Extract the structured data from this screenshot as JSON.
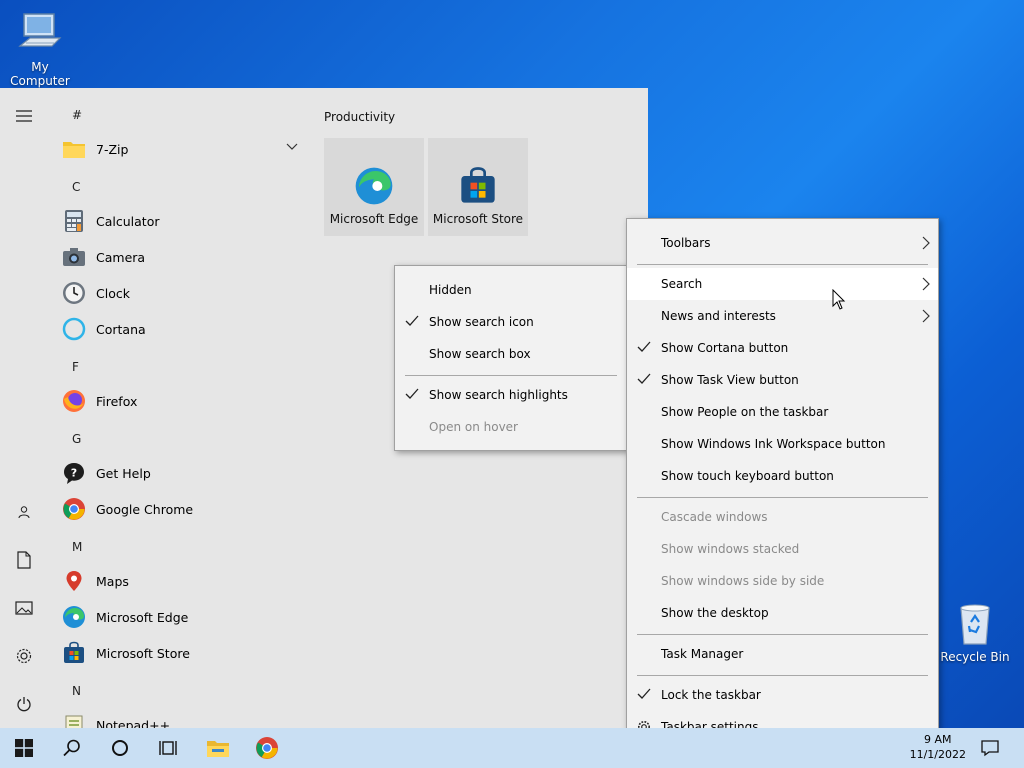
{
  "desktop": {
    "my_computer": "My Computer",
    "recycle_bin": "Recycle Bin"
  },
  "start_menu": {
    "tiles_group": "Productivity",
    "tiles": [
      {
        "label": "Microsoft Edge",
        "icon": "edge-icon"
      },
      {
        "label": "Microsoft Store",
        "icon": "store-icon"
      }
    ],
    "apps": [
      {
        "type": "letter",
        "text": "#"
      },
      {
        "type": "app",
        "label": "7-Zip",
        "icon": "folder-icon",
        "expandable": true
      },
      {
        "type": "letter",
        "text": "C"
      },
      {
        "type": "app",
        "label": "Calculator",
        "icon": "calculator-icon"
      },
      {
        "type": "app",
        "label": "Camera",
        "icon": "camera-icon"
      },
      {
        "type": "app",
        "label": "Clock",
        "icon": "clock-icon"
      },
      {
        "type": "app",
        "label": "Cortana",
        "icon": "cortana-icon"
      },
      {
        "type": "letter",
        "text": "F"
      },
      {
        "type": "app",
        "label": "Firefox",
        "icon": "firefox-icon"
      },
      {
        "type": "letter",
        "text": "G"
      },
      {
        "type": "app",
        "label": "Get Help",
        "icon": "get-help-icon"
      },
      {
        "type": "app",
        "label": "Google Chrome",
        "icon": "chrome-icon"
      },
      {
        "type": "letter",
        "text": "M"
      },
      {
        "type": "app",
        "label": "Maps",
        "icon": "maps-icon"
      },
      {
        "type": "app",
        "label": "Microsoft Edge",
        "icon": "edge-icon"
      },
      {
        "type": "app",
        "label": "Microsoft Store",
        "icon": "store-icon"
      },
      {
        "type": "letter",
        "text": "N"
      },
      {
        "type": "app",
        "label": "Notepad++",
        "icon": "notepad-icon"
      }
    ]
  },
  "taskbar_menu": {
    "items": [
      {
        "label": "Toolbars",
        "submenu": true
      },
      {
        "sep": true
      },
      {
        "label": "Search",
        "submenu": true,
        "highlighted": true
      },
      {
        "label": "News and interests",
        "submenu": true
      },
      {
        "label": "Show Cortana button",
        "checked": true
      },
      {
        "label": "Show Task View button",
        "checked": true
      },
      {
        "label": "Show People on the taskbar"
      },
      {
        "label": "Show Windows Ink Workspace button"
      },
      {
        "label": "Show touch keyboard button"
      },
      {
        "sep": true
      },
      {
        "label": "Cascade windows",
        "disabled": true
      },
      {
        "label": "Show windows stacked",
        "disabled": true
      },
      {
        "label": "Show windows side by side",
        "disabled": true
      },
      {
        "label": "Show the desktop"
      },
      {
        "sep": true
      },
      {
        "label": "Task Manager"
      },
      {
        "sep": true
      },
      {
        "label": "Lock the taskbar",
        "checked": true
      },
      {
        "label": "Taskbar settings",
        "gear": true
      }
    ]
  },
  "search_submenu": {
    "items": [
      {
        "label": "Hidden"
      },
      {
        "label": "Show search icon",
        "checked": true
      },
      {
        "label": "Show search box"
      },
      {
        "sep": true
      },
      {
        "label": "Show search highlights",
        "checked": true
      },
      {
        "label": "Open on hover",
        "disabled": true
      }
    ]
  },
  "taskbar": {
    "time": "9 AM",
    "date": "11/1/2022"
  }
}
